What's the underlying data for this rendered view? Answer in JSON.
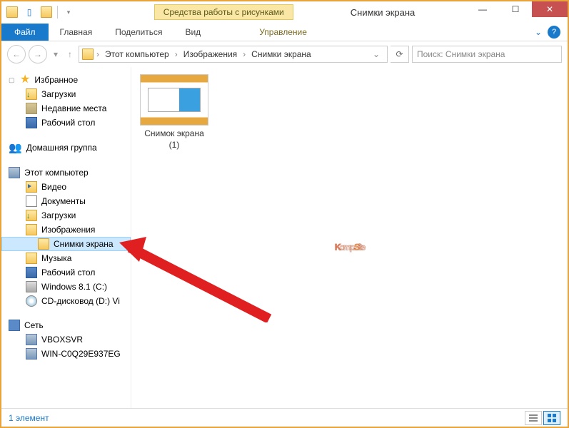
{
  "titlebar": {
    "context_tab": "Средства работы с рисунками",
    "window_title": "Снимки экрана"
  },
  "ribbon": {
    "file": "Файл",
    "tabs": [
      "Главная",
      "Поделиться",
      "Вид"
    ],
    "context_tab": "Управление"
  },
  "breadcrumb": {
    "items": [
      "Этот компьютер",
      "Изображения",
      "Снимки экрана"
    ]
  },
  "search": {
    "placeholder": "Поиск: Снимки экрана"
  },
  "sidebar": {
    "favorites": {
      "label": "Избранное",
      "items": [
        "Загрузки",
        "Недавние места",
        "Рабочий стол"
      ]
    },
    "homegroup": {
      "label": "Домашняя группа"
    },
    "computer": {
      "label": "Этот компьютер",
      "items": [
        "Видео",
        "Документы",
        "Загрузки",
        "Изображения"
      ],
      "subselected": "Снимки экрана",
      "items2": [
        "Музыка",
        "Рабочий стол",
        "Windows 8.1 (C:)",
        "CD-дисковод (D:) Vi"
      ]
    },
    "network": {
      "label": "Сеть",
      "items": [
        "VBOXSVR",
        "WIN-C0Q29E937EG"
      ]
    }
  },
  "content": {
    "file_name": "Снимок экрана (1)"
  },
  "status": {
    "text": "1 элемент"
  },
  "watermark": {
    "k": "K",
    "omp": "omp.",
    "s": "S",
    "ite": "ite"
  }
}
